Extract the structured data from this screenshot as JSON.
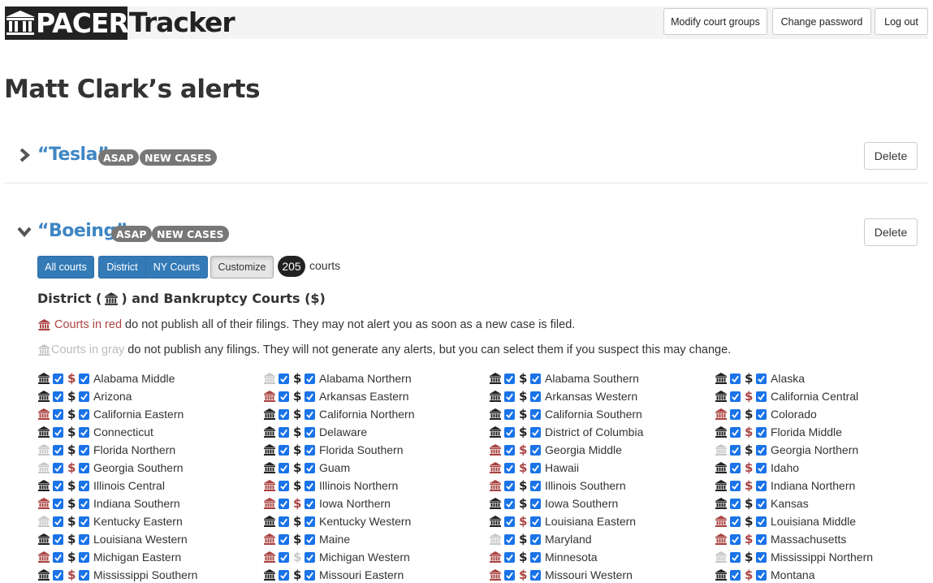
{
  "header": {
    "logo_left": "PACER",
    "logo_right": "Tracker",
    "buttons": [
      "Modify court groups",
      "Change password",
      "Log out"
    ]
  },
  "page_title": "Matt Clark’s alerts",
  "alerts": [
    {
      "name": "“Tesla”",
      "badges": [
        "ASAP",
        "NEW CASES"
      ],
      "expanded": false,
      "delete_label": "Delete"
    },
    {
      "name": "“Boeing”",
      "badges": [
        "ASAP",
        "NEW CASES"
      ],
      "expanded": true,
      "delete_label": "Delete"
    }
  ],
  "court_selector": {
    "buttons": [
      "All courts",
      "District",
      "NY Courts",
      "Customize"
    ],
    "count": "205",
    "count_label": "courts",
    "section_title_1": "District (",
    "section_title_2": ") and Bankruptcy Courts (",
    "section_title_3": "$",
    "section_title_4": ")",
    "note_red_highlight": "Courts in red",
    "note_red_rest": " do not publish all of their filings. They may not alert you as soon as a new case is filed.",
    "note_gray_highlight": "Courts in gray",
    "note_gray_rest": " do not publish any filings. They will not generate any alerts, but you can select them if you suspect this may change."
  },
  "colors": {
    "link_blue": "#3f86c4",
    "btn_blue": "#337ab7",
    "red": "#a94442",
    "gray": "#c8c8c8",
    "checkbox": "#1a73e8"
  },
  "courts": [
    {
      "name": "Alabama Middle",
      "district": "black",
      "bankruptcy": "red"
    },
    {
      "name": "Alabama Northern",
      "district": "gray",
      "bankruptcy": "black"
    },
    {
      "name": "Alabama Southern",
      "district": "black",
      "bankruptcy": "black"
    },
    {
      "name": "Alaska",
      "district": "black",
      "bankruptcy": "black"
    },
    {
      "name": "Arizona",
      "district": "black",
      "bankruptcy": "black"
    },
    {
      "name": "Arkansas Eastern",
      "district": "red",
      "bankruptcy": "black"
    },
    {
      "name": "Arkansas Western",
      "district": "black",
      "bankruptcy": "black"
    },
    {
      "name": "California Central",
      "district": "black",
      "bankruptcy": "red"
    },
    {
      "name": "California Eastern",
      "district": "red",
      "bankruptcy": "black"
    },
    {
      "name": "California Northern",
      "district": "black",
      "bankruptcy": "black"
    },
    {
      "name": "California Southern",
      "district": "black",
      "bankruptcy": "black"
    },
    {
      "name": "Colorado",
      "district": "red",
      "bankruptcy": "black"
    },
    {
      "name": "Connecticut",
      "district": "black",
      "bankruptcy": "black"
    },
    {
      "name": "Delaware",
      "district": "black",
      "bankruptcy": "black"
    },
    {
      "name": "District of Columbia",
      "district": "black",
      "bankruptcy": "black"
    },
    {
      "name": "Florida Middle",
      "district": "black",
      "bankruptcy": "red"
    },
    {
      "name": "Florida Northern",
      "district": "gray",
      "bankruptcy": "black"
    },
    {
      "name": "Florida Southern",
      "district": "black",
      "bankruptcy": "black"
    },
    {
      "name": "Georgia Middle",
      "district": "red",
      "bankruptcy": "red"
    },
    {
      "name": "Georgia Northern",
      "district": "gray",
      "bankruptcy": "black"
    },
    {
      "name": "Georgia Southern",
      "district": "gray",
      "bankruptcy": "red"
    },
    {
      "name": "Guam",
      "district": "black",
      "bankruptcy": "black"
    },
    {
      "name": "Hawaii",
      "district": "red",
      "bankruptcy": "red"
    },
    {
      "name": "Idaho",
      "district": "black",
      "bankruptcy": "red"
    },
    {
      "name": "Illinois Central",
      "district": "black",
      "bankruptcy": "black"
    },
    {
      "name": "Illinois Northern",
      "district": "red",
      "bankruptcy": "black"
    },
    {
      "name": "Illinois Southern",
      "district": "red",
      "bankruptcy": "black"
    },
    {
      "name": "Indiana Northern",
      "district": "black",
      "bankruptcy": "red"
    },
    {
      "name": "Indiana Southern",
      "district": "red",
      "bankruptcy": "black"
    },
    {
      "name": "Iowa Northern",
      "district": "red",
      "bankruptcy": "red"
    },
    {
      "name": "Iowa Southern",
      "district": "black",
      "bankruptcy": "black"
    },
    {
      "name": "Kansas",
      "district": "black",
      "bankruptcy": "black"
    },
    {
      "name": "Kentucky Eastern",
      "district": "gray",
      "bankruptcy": "black"
    },
    {
      "name": "Kentucky Western",
      "district": "black",
      "bankruptcy": "black"
    },
    {
      "name": "Louisiana Eastern",
      "district": "black",
      "bankruptcy": "red"
    },
    {
      "name": "Louisiana Middle",
      "district": "red",
      "bankruptcy": "black"
    },
    {
      "name": "Louisiana Western",
      "district": "black",
      "bankruptcy": "black"
    },
    {
      "name": "Maine",
      "district": "red",
      "bankruptcy": "black"
    },
    {
      "name": "Maryland",
      "district": "gray",
      "bankruptcy": "black"
    },
    {
      "name": "Massachusetts",
      "district": "red",
      "bankruptcy": "red"
    },
    {
      "name": "Michigan Eastern",
      "district": "red",
      "bankruptcy": "black"
    },
    {
      "name": "Michigan Western",
      "district": "red",
      "bankruptcy": "gray"
    },
    {
      "name": "Minnesota",
      "district": "red",
      "bankruptcy": "black"
    },
    {
      "name": "Mississippi Northern",
      "district": "gray",
      "bankruptcy": "black"
    },
    {
      "name": "Mississippi Southern",
      "district": "black",
      "bankruptcy": "red"
    },
    {
      "name": "Missouri Eastern",
      "district": "black",
      "bankruptcy": "black"
    },
    {
      "name": "Missouri Western",
      "district": "red",
      "bankruptcy": "red"
    },
    {
      "name": "Montana",
      "district": "black",
      "bankruptcy": "red"
    }
  ]
}
